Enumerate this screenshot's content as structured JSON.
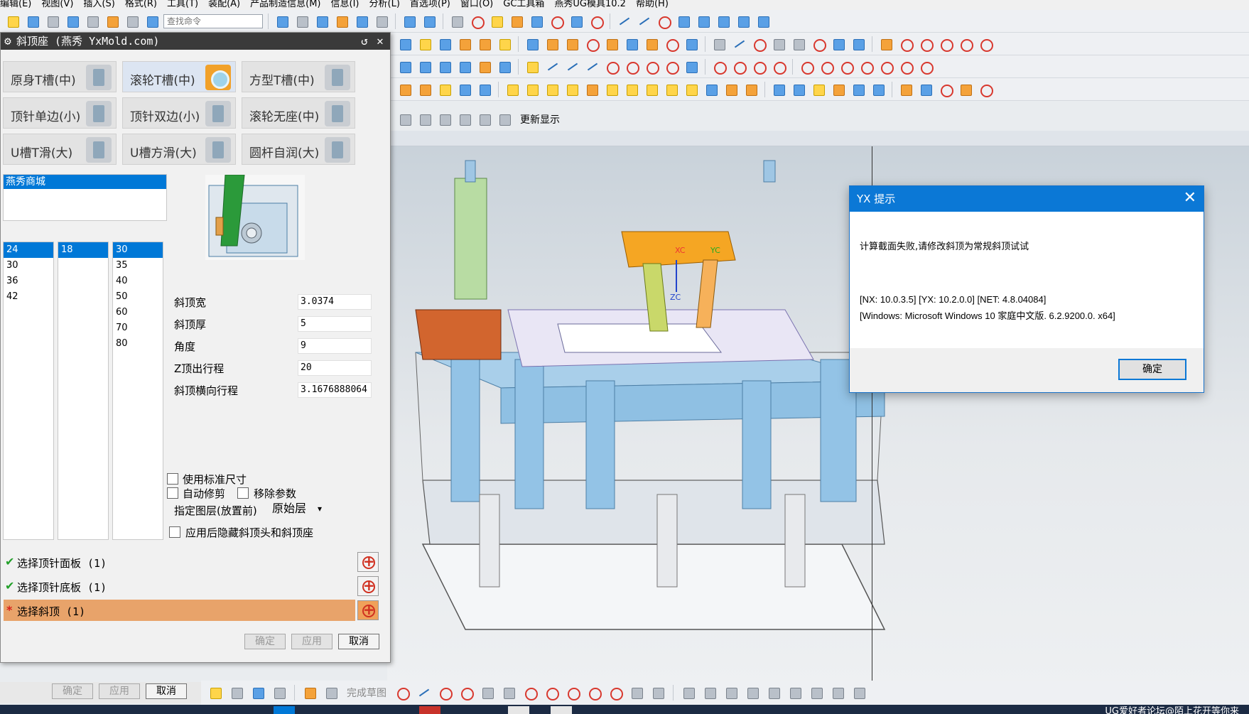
{
  "menu": [
    "编辑(E)",
    "视图(V)",
    "插入(S)",
    "格式(R)",
    "工具(T)",
    "装配(A)",
    "产品制造信息(M)",
    "信息(I)",
    "分析(L)",
    "首选项(P)",
    "窗口(O)",
    "GC工具箱",
    "燕秀UG模具10.2",
    "帮助(H)"
  ],
  "toolbar": {
    "search_placeholder": "查找命令",
    "update_display": "更新显示",
    "finish_sketch": "完成草图"
  },
  "dialog": {
    "title": "斜顶座 (燕秀 YxMold.com)",
    "types": [
      {
        "label": "原身T槽(中)",
        "selected": false
      },
      {
        "label": "滚轮T槽(中)",
        "selected": true
      },
      {
        "label": "方型T槽(中)",
        "selected": false
      },
      {
        "label": "顶针单边(小)",
        "selected": false
      },
      {
        "label": "顶针双边(小)",
        "selected": false
      },
      {
        "label": "滚轮无座(中)",
        "selected": false
      },
      {
        "label": "U槽T滑(大)",
        "selected": false
      },
      {
        "label": "U槽方滑(大)",
        "selected": false
      },
      {
        "label": "圆杆自润(大)",
        "selected": false
      }
    ],
    "shop": "燕秀商城",
    "col1": [
      "24",
      "30",
      "36",
      "42"
    ],
    "col2": [
      "18"
    ],
    "col3": [
      "30",
      "35",
      "40",
      "50",
      "60",
      "70",
      "80"
    ],
    "params": [
      {
        "label": "斜顶宽",
        "value": "3.0374"
      },
      {
        "label": "斜顶厚",
        "value": "5"
      },
      {
        "label": "角度",
        "value": "9"
      },
      {
        "label": "Z顶出行程",
        "value": "20"
      },
      {
        "label": "斜顶横向行程",
        "value": "3.1676888064"
      }
    ],
    "options": {
      "use_std": "使用标准尺寸",
      "auto_trim": "自动修剪",
      "remove_params": "移除参数",
      "layer_label": "指定图层(放置前)",
      "layer_value": "原始层",
      "hide_after": "应用后隐藏斜顶头和斜顶座"
    },
    "selections": [
      "选择顶针面板 (1)",
      "选择顶针底板 (1)",
      "选择斜顶 (1)"
    ],
    "buttons": {
      "ok": "确定",
      "apply": "应用",
      "cancel": "取消"
    }
  },
  "bottom_buttons": {
    "ok": "确定",
    "apply": "应用",
    "cancel": "取消"
  },
  "message": {
    "title": "YX 提示",
    "text": "计算截面失败,请修改斜顶为常规斜顶试试",
    "info1": "[NX: 10.0.3.5] [YX: 10.2.0.0] [NET: 4.8.04084]",
    "info2": "[Windows: Microsoft Windows 10 家庭中文版. 6.2.9200.0. x64]",
    "ok": "确定"
  },
  "viewport": {
    "axis_xc": "XC",
    "axis_yc": "YC",
    "axis_zc": "ZC"
  },
  "watermark": "UG爱好者论坛@陌上花开等你来",
  "colors": {
    "accent": "#0078d7",
    "mold_blue": "#8fc0e3",
    "mold_orange": "#d2652e",
    "slider_orange": "#f5a623"
  }
}
